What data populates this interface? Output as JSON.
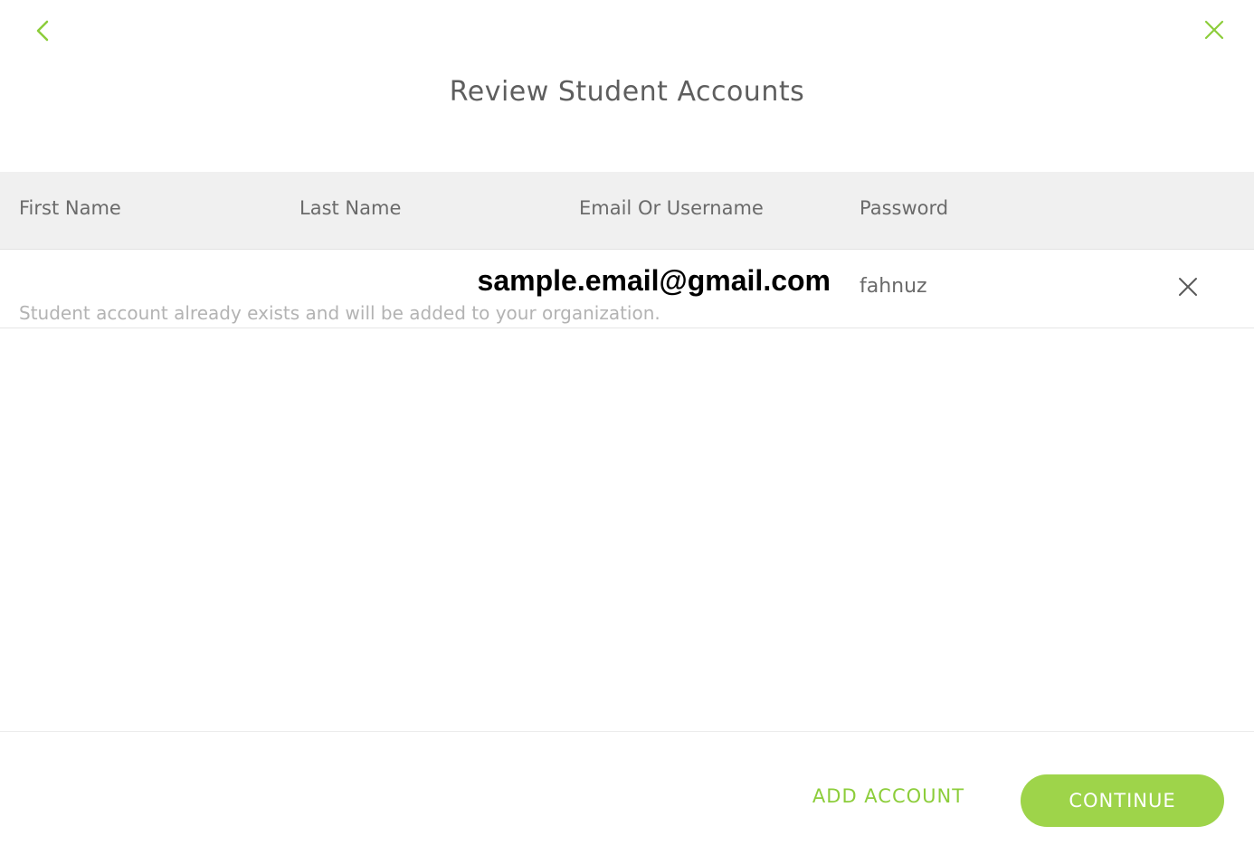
{
  "header": {
    "title": "Review Student Accounts",
    "back_icon": "chevron-left-icon",
    "close_icon": "close-icon"
  },
  "table": {
    "columns": [
      "First Name",
      "Last Name",
      "Email Or Username",
      "Password"
    ],
    "rows": [
      {
        "first_name": "",
        "last_name": "",
        "email": "sample.email@gmail.com",
        "password": "fahnuz",
        "note": "Student account already exists and will be added to your organization.",
        "remove_icon": "close-icon"
      }
    ]
  },
  "footer": {
    "add_account_label": "ADD ACCOUNT",
    "continue_label": "CONTINUE"
  },
  "colors": {
    "accent": "#9ed44a",
    "accent_text": "#8ccd3a",
    "header_bg": "#f0f0f0",
    "text": "#5e5e5e",
    "muted": "#b3b3b3"
  }
}
